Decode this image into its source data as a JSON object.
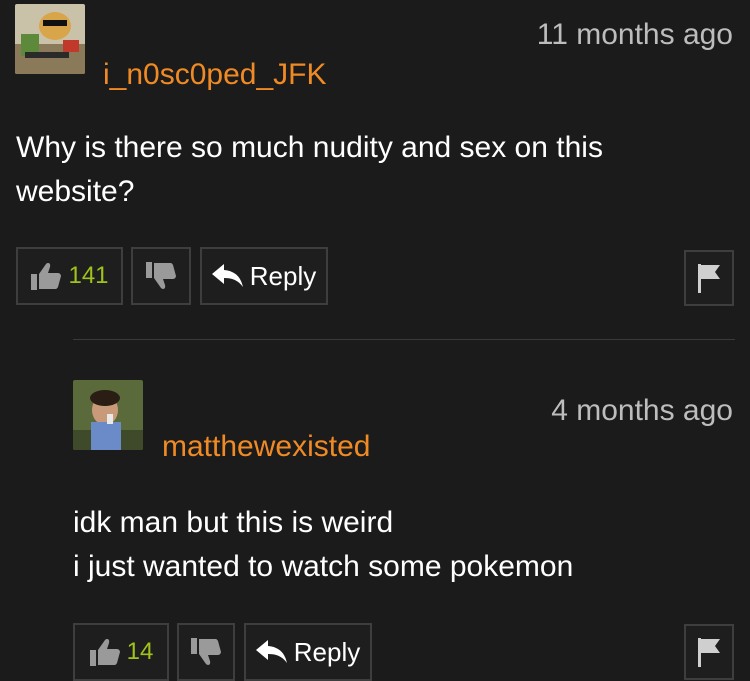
{
  "comments": [
    {
      "username": "i_n0sc0ped_JFK",
      "timestamp": "11 months ago",
      "lines": [
        "Why is there so much nudity and sex on this",
        "website?"
      ],
      "likes": "141",
      "reply_label": "Reply"
    },
    {
      "username": "matthewexisted",
      "timestamp": "4 months ago",
      "lines": [
        "idk man but this is weird",
        "i just wanted to watch some pokemon"
      ],
      "likes": "14",
      "reply_label": "Reply"
    }
  ],
  "icons": {
    "like": "thumbs-up-icon",
    "dislike": "thumbs-down-icon",
    "reply": "reply-arrow-icon",
    "flag": "flag-icon"
  },
  "colors": {
    "background": "#1b1b1b",
    "username": "#f08a24",
    "like_count": "#9fc31a",
    "timestamp": "#bdbdbd"
  }
}
